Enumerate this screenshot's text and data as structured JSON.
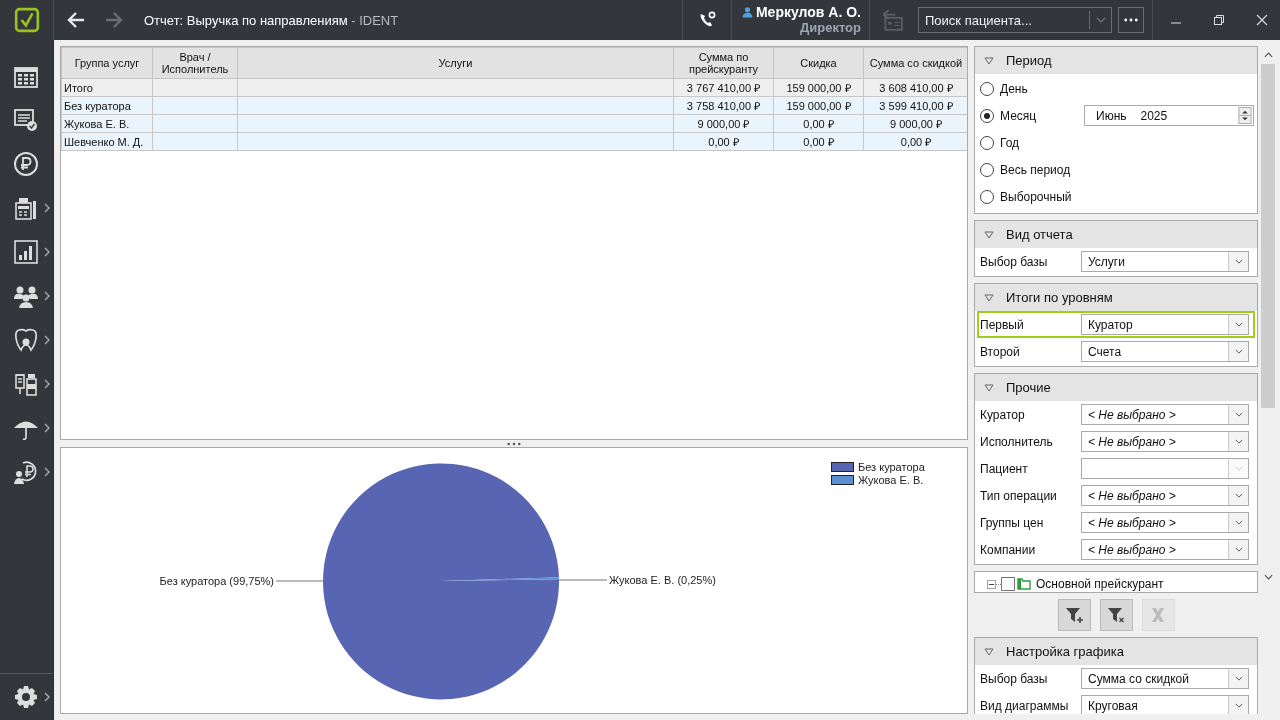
{
  "window": {
    "title": "Отчет: Выручка по направлениям",
    "app_name": " - IDENT"
  },
  "nav": {
    "back_disabled": false,
    "forward_disabled": true
  },
  "user": {
    "name": "Меркулов А. О.",
    "role": "Директор"
  },
  "search": {
    "placeholder": "Поиск пациента..."
  },
  "sidebar": {
    "items": [
      {
        "kind": "calendar",
        "submenu": false
      },
      {
        "kind": "tasks",
        "submenu": false
      },
      {
        "kind": "ruble",
        "submenu": false
      },
      {
        "kind": "cashier",
        "submenu": true
      },
      {
        "kind": "stats",
        "submenu": true
      },
      {
        "kind": "people",
        "submenu": true
      },
      {
        "kind": "tooth",
        "submenu": true
      },
      {
        "kind": "supplies",
        "submenu": true
      },
      {
        "kind": "umbrella",
        "submenu": true
      },
      {
        "kind": "payer",
        "submenu": true
      }
    ],
    "settings": {
      "submenu": true
    }
  },
  "table": {
    "columns": [
      {
        "label": "Группа услуг"
      },
      {
        "label": "Врач / Исполнитель"
      },
      {
        "label": "Услуги"
      },
      {
        "label": "Сумма по прейскуранту"
      },
      {
        "label": "Скидка"
      },
      {
        "label": "Сумма со скидкой"
      }
    ],
    "rows": [
      {
        "kind": "total",
        "cells": [
          "Итого",
          "",
          "",
          "3 767 410,00 ₽",
          "159 000,00 ₽",
          "3 608 410,00 ₽"
        ]
      },
      {
        "kind": "group",
        "cells": [
          "Без куратора",
          "",
          "",
          "3 758 410,00 ₽",
          "159 000,00 ₽",
          "3 599 410,00 ₽"
        ]
      },
      {
        "kind": "group",
        "cells": [
          "Жукова Е. В.",
          "",
          "",
          "9 000,00 ₽",
          "0,00 ₽",
          "9 000,00 ₽"
        ]
      },
      {
        "kind": "group",
        "cells": [
          "Шевченко М. Д.",
          "",
          "",
          "0,00 ₽",
          "0,00 ₽",
          "0,00 ₽"
        ]
      }
    ]
  },
  "chart": {
    "chart_data": {
      "type": "pie",
      "categories": [
        "Без куратора",
        "Жукова Е. В."
      ],
      "values": [
        99.75,
        0.25
      ],
      "colors": [
        "#5865b2",
        "#5b8fd0"
      ],
      "value_labels": [
        "Без куратора (99,75%)",
        "Жукова Е. В. (0,25%)"
      ],
      "legend": "top-right"
    }
  },
  "period": {
    "title": "Период",
    "options": [
      {
        "label": "День",
        "selected": false
      },
      {
        "label": "Месяц",
        "selected": true,
        "month": "Июнь",
        "year": "2025"
      },
      {
        "label": "Год",
        "selected": false
      },
      {
        "label": "Весь период",
        "selected": false
      },
      {
        "label": "Выборочный",
        "selected": false
      }
    ]
  },
  "sections": [
    {
      "title": "Вид отчета",
      "fields": [
        {
          "label": "Выбор базы",
          "value": "Услуги",
          "disabled": false,
          "highlighted": false
        }
      ]
    },
    {
      "title": "Итоги по уровням",
      "fields": [
        {
          "label": "Первый",
          "value": "Куратор",
          "disabled": false,
          "highlighted": true
        },
        {
          "label": "Второй",
          "value": "Счета",
          "disabled": false,
          "highlighted": false
        }
      ]
    },
    {
      "title": "Прочие",
      "fields": [
        {
          "label": "Куратор",
          "placeholder": "< Не выбрано >",
          "disabled": false,
          "highlighted": false
        },
        {
          "label": "Исполнитель",
          "placeholder": "< Не выбрано >",
          "disabled": false,
          "highlighted": false
        },
        {
          "label": "Пациент",
          "disabled": true,
          "highlighted": false
        },
        {
          "label": "Тип операции",
          "placeholder": "< Не выбрано >",
          "disabled": false,
          "highlighted": false
        },
        {
          "label": "Группы цен",
          "placeholder": "< Не выбрано >",
          "disabled": false,
          "highlighted": false
        },
        {
          "label": "Компании",
          "placeholder": "< Не выбрано >",
          "disabled": false,
          "highlighted": false
        }
      ]
    }
  ],
  "price_tree": {
    "items": [
      {
        "label": "Основной прейскурант",
        "checked": false,
        "expanded": true
      }
    ]
  },
  "filter_buttons": [
    {
      "kind": "add-filter",
      "disabled": false
    },
    {
      "kind": "remove-filter",
      "disabled": false
    },
    {
      "kind": "clear",
      "disabled": true
    }
  ],
  "chart_settings": {
    "title": "Настройка графика",
    "fields": [
      {
        "label": "Выбор базы",
        "value": "Сумма со скидкой",
        "disabled": false,
        "highlighted": false
      },
      {
        "label": "Вид диаграммы",
        "value": "Круговая",
        "disabled": false,
        "highlighted": false
      }
    ]
  }
}
